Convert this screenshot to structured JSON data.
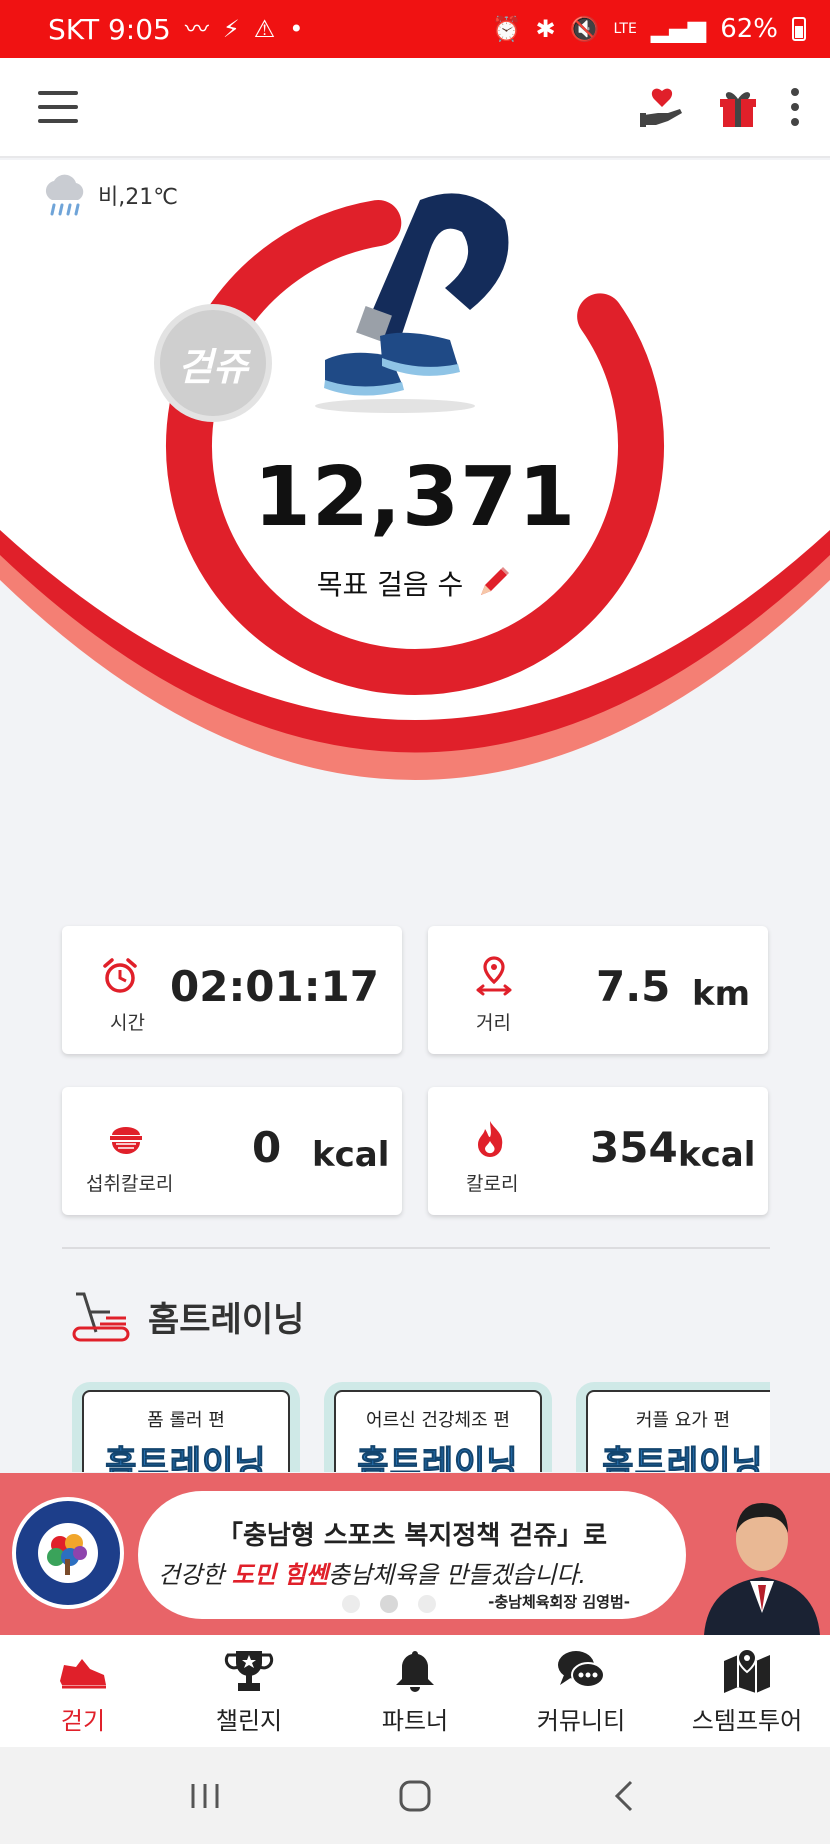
{
  "status_bar": {
    "carrier_time": "SKT 9:05",
    "battery": "62%",
    "network": "LTE"
  },
  "weather": {
    "text": "비,21℃",
    "icon": "rain-cloud-icon"
  },
  "hero": {
    "badge": "걷쥬",
    "steps": "12,371",
    "goal_label": "목표 걸음 수"
  },
  "stats": [
    {
      "label": "시간",
      "value": "02:01:17",
      "unit": "",
      "icon": "alarm-clock-icon"
    },
    {
      "label": "거리",
      "value": "7.5",
      "unit": "km",
      "icon": "location-distance-icon"
    },
    {
      "label": "섭취칼로리",
      "value": "0",
      "unit": "kcal",
      "icon": "rice-bowl-icon"
    },
    {
      "label": "칼로리",
      "value": "354",
      "unit": "kcal",
      "icon": "flame-icon"
    }
  ],
  "home_training": {
    "title": "홈트레이닝",
    "items": [
      {
        "label": "폼 롤러 편",
        "big": "홈트레이닝"
      },
      {
        "label": "어르신 건강체조 편",
        "big": "홈트레이닝"
      },
      {
        "label": "커플 요가 편",
        "big": "홈트레이닝"
      }
    ]
  },
  "banner": {
    "line1": "「충남형 스포츠 복지정책 걷쥬」로",
    "line2_a": "건강한 ",
    "line2_b": "도민",
    "line2_c": "  ",
    "line2_d": "힘쎈",
    "line2_e": "충남체육을 만들겠습니다.",
    "line3": "-충남체육회장 김영범-",
    "logo_text": "Chungnam Sports Council"
  },
  "bottom_nav": [
    {
      "label": "걷기",
      "icon": "sneaker-icon",
      "active": true
    },
    {
      "label": "챌린지",
      "icon": "trophy-icon",
      "active": false
    },
    {
      "label": "파트너",
      "icon": "bell-icon",
      "active": false
    },
    {
      "label": "커뮤니티",
      "icon": "chat-bubbles-icon",
      "active": false
    },
    {
      "label": "스템프투어",
      "icon": "map-pin-icon",
      "active": false
    }
  ],
  "colors": {
    "accent": "#f01212",
    "ring": "#e0202a",
    "ring_light": "#f47f74",
    "bg": "#f2f3f6"
  }
}
